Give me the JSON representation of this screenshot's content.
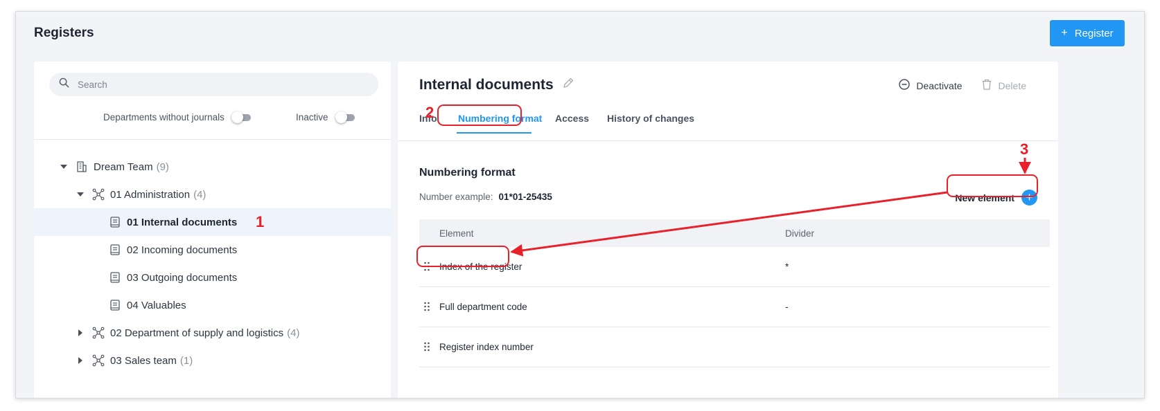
{
  "header": {
    "title": "Registers",
    "register_button": "Register"
  },
  "sidebar": {
    "search_placeholder": "Search",
    "toggle_departments_label": "Departments without journals",
    "toggle_inactive_label": "Inactive",
    "tree": [
      {
        "label": "Dream Team",
        "count": "(9)"
      },
      {
        "label": "01 Administration",
        "count": "(4)"
      },
      {
        "label": "01 Internal documents"
      },
      {
        "label": "02 Incoming documents"
      },
      {
        "label": "03 Outgoing documents"
      },
      {
        "label": "04 Valuables"
      },
      {
        "label": "02 Department of supply and logistics",
        "count": "(4)"
      },
      {
        "label": "03 Sales team",
        "count": "(1)"
      }
    ]
  },
  "main": {
    "title": "Internal documents",
    "actions": {
      "deactivate": "Deactivate",
      "delete": "Delete"
    },
    "tabs": [
      "Info",
      "Numbering format",
      "Access",
      "History of changes"
    ],
    "active_tab": "Numbering format",
    "section_title": "Numbering format",
    "number_example_label": "Number example:",
    "number_example_value": "01*01-25435",
    "new_element_label": "New element",
    "table": {
      "headers": [
        "Element",
        "Divider"
      ],
      "rows": [
        {
          "element": "Index of the register",
          "divider": "*"
        },
        {
          "element": "Full department code",
          "divider": "-"
        },
        {
          "element": "Register index number",
          "divider": ""
        }
      ]
    }
  },
  "annotations": {
    "marker_1": "1",
    "marker_2": "2",
    "marker_3": "3",
    "color": "#e8202a"
  },
  "colors": {
    "accent": "#2196f3",
    "selected_row": "#eef4fb"
  }
}
